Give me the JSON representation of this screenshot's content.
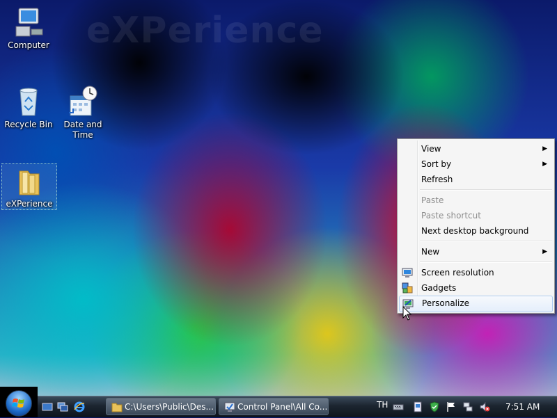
{
  "wallpaper": {
    "watermark": "eXPerience"
  },
  "desktop_icons": [
    {
      "label": "Computer"
    },
    {
      "label": "Recycle Bin"
    },
    {
      "label": "Date and Time"
    },
    {
      "label": "eXPerience"
    }
  ],
  "context_menu": {
    "items": [
      {
        "label": "View",
        "submenu": true
      },
      {
        "label": "Sort by",
        "submenu": true
      },
      {
        "label": "Refresh"
      },
      {
        "label": "Paste",
        "disabled": true
      },
      {
        "label": "Paste shortcut",
        "disabled": true
      },
      {
        "label": "Next desktop background"
      },
      {
        "label": "New",
        "submenu": true
      },
      {
        "label": "Screen resolution",
        "icon": "monitor-icon"
      },
      {
        "label": "Gadgets",
        "icon": "gadgets-icon"
      },
      {
        "label": "Personalize",
        "icon": "personalize-icon",
        "highlighted": true
      }
    ],
    "submenu_arrow": "▶"
  },
  "taskbar": {
    "tasks": [
      {
        "label": "C:\\Users\\Public\\Des...",
        "icon": "folder-icon"
      },
      {
        "label": "Control Panel\\All Co...",
        "icon": "control-panel-icon"
      }
    ],
    "language": "TH",
    "clock": "7:51 AM"
  },
  "colors": {
    "menu_bg": "#f5f5f5",
    "highlight_border": "#aeccf0",
    "taskbar": "#1c2530"
  }
}
